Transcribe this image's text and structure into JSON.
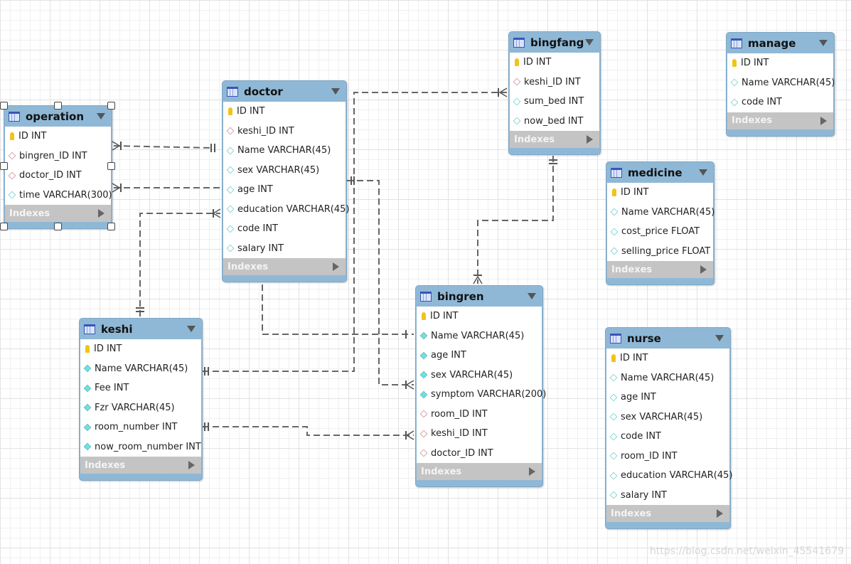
{
  "tables": {
    "operation": {
      "name": "operation",
      "indexes": "Indexes",
      "columns": [
        {
          "text": "ID INT",
          "type": "pk"
        },
        {
          "text": "bingren_ID INT",
          "type": "fk"
        },
        {
          "text": "doctor_ID INT",
          "type": "fk"
        },
        {
          "text": "time VARCHAR(300)",
          "type": "col"
        }
      ]
    },
    "doctor": {
      "name": "doctor",
      "indexes": "Indexes",
      "columns": [
        {
          "text": "ID INT",
          "type": "pk"
        },
        {
          "text": "keshi_ID INT",
          "type": "fk"
        },
        {
          "text": "Name VARCHAR(45)",
          "type": "col"
        },
        {
          "text": "sex VARCHAR(45)",
          "type": "col"
        },
        {
          "text": "age INT",
          "type": "col"
        },
        {
          "text": "education VARCHAR(45)",
          "type": "col"
        },
        {
          "text": "code INT",
          "type": "col"
        },
        {
          "text": "salary INT",
          "type": "col"
        }
      ]
    },
    "bingfang": {
      "name": "bingfang",
      "indexes": "Indexes",
      "columns": [
        {
          "text": "ID INT",
          "type": "pk"
        },
        {
          "text": "keshi_ID INT",
          "type": "fk"
        },
        {
          "text": "sum_bed INT",
          "type": "col"
        },
        {
          "text": "now_bed INT",
          "type": "col"
        }
      ]
    },
    "manage": {
      "name": "manage",
      "indexes": "Indexes",
      "columns": [
        {
          "text": "ID INT",
          "type": "pk"
        },
        {
          "text": "Name VARCHAR(45)",
          "type": "col"
        },
        {
          "text": "code INT",
          "type": "col"
        }
      ]
    },
    "medicine": {
      "name": "medicine",
      "indexes": "Indexes",
      "columns": [
        {
          "text": "ID INT",
          "type": "pk"
        },
        {
          "text": "Name VARCHAR(45)",
          "type": "col"
        },
        {
          "text": "cost_price FLOAT",
          "type": "col"
        },
        {
          "text": "selling_price FLOAT",
          "type": "col"
        }
      ]
    },
    "bingren": {
      "name": "bingren",
      "indexes": "Indexes",
      "columns": [
        {
          "text": "ID INT",
          "type": "pk"
        },
        {
          "text": "Name VARCHAR(45)",
          "type": "nn"
        },
        {
          "text": "age INT",
          "type": "nn"
        },
        {
          "text": "sex VARCHAR(45)",
          "type": "nn"
        },
        {
          "text": "symptom VARCHAR(200)",
          "type": "nn"
        },
        {
          "text": "room_ID INT",
          "type": "fk"
        },
        {
          "text": "keshi_ID INT",
          "type": "fk"
        },
        {
          "text": "doctor_ID INT",
          "type": "fk"
        }
      ]
    },
    "keshi": {
      "name": "keshi",
      "indexes": "Indexes",
      "columns": [
        {
          "text": "ID INT",
          "type": "pk"
        },
        {
          "text": "Name VARCHAR(45)",
          "type": "nn"
        },
        {
          "text": "Fee INT",
          "type": "nn"
        },
        {
          "text": "Fzr VARCHAR(45)",
          "type": "nn"
        },
        {
          "text": "room_number INT",
          "type": "nn"
        },
        {
          "text": "now_room_number INT",
          "type": "nn"
        }
      ]
    },
    "nurse": {
      "name": "nurse",
      "indexes": "Indexes",
      "columns": [
        {
          "text": "ID INT",
          "type": "pk"
        },
        {
          "text": "Name VARCHAR(45)",
          "type": "col"
        },
        {
          "text": "age INT",
          "type": "col"
        },
        {
          "text": "sex VARCHAR(45)",
          "type": "col"
        },
        {
          "text": "code INT",
          "type": "col"
        },
        {
          "text": "room_ID INT",
          "type": "col"
        },
        {
          "text": "education VARCHAR(45)",
          "type": "col"
        },
        {
          "text": "salary INT",
          "type": "col"
        }
      ]
    }
  },
  "selected_table": "operation",
  "colors": {
    "header": "#8fb8d6",
    "indexes": "#c4c4c4",
    "primary_key": "#f0c419",
    "link": "#666666"
  },
  "watermark": "https://blog.csdn.net/weixin_45541679"
}
